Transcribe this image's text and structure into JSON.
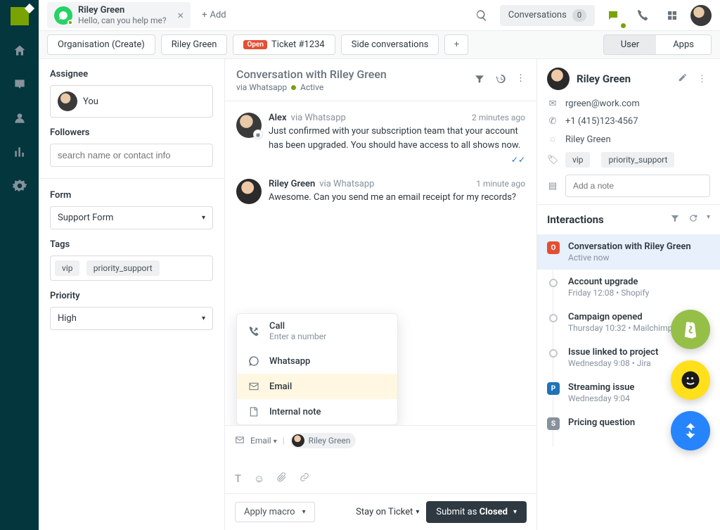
{
  "topbar": {
    "chat_tab": {
      "title": "Riley Green",
      "subtitle": "Hello, can you help me?"
    },
    "add_label": "Add",
    "conversations_label": "Conversations",
    "conversations_count": "0"
  },
  "tabs": {
    "items": [
      "Organisation (Create)",
      "Riley Green"
    ],
    "ticket": {
      "badge": "Open",
      "label": "Ticket #1234"
    },
    "side": "Side conversations",
    "seg_user": "User",
    "seg_apps": "Apps"
  },
  "left": {
    "assignee_label": "Assignee",
    "assignee_value": "You",
    "followers_label": "Followers",
    "followers_placeholder": "search name or contact info",
    "form_label": "Form",
    "form_value": "Support Form",
    "tags_label": "Tags",
    "tags": [
      "vip",
      "priority_support"
    ],
    "priority_label": "Priority",
    "priority_value": "High"
  },
  "conversation": {
    "title": "Conversation with Riley Green",
    "via": "via Whatsapp",
    "status": "Active",
    "messages": [
      {
        "name": "Alex",
        "via": "via Whatsapp",
        "time": "2 minutes ago",
        "text": "Just confirmed with your subscription team that your account has been upgraded. You should have access to all shows now.",
        "checks": true
      },
      {
        "name": "Riley Green",
        "via": "via Whatsapp",
        "time": "1 minute ago",
        "text": "Awesome. Can you send me an email receipt for my records?"
      }
    ],
    "reply_menu": {
      "call": "Call",
      "call_sub": "Enter a number",
      "whatsapp": "Whatsapp",
      "email": "Email",
      "internal": "Internal note"
    },
    "reply_channel": "Email",
    "reply_to": "Riley Green",
    "macro_label": "Apply macro",
    "stay_label": "Stay on Ticket",
    "submit_prefix": "Submit as ",
    "submit_status": "Closed"
  },
  "customer": {
    "name": "Riley Green",
    "email": "rgreen@work.com",
    "phone": "+1 (415)123-4567",
    "whatsapp": "Riley Green",
    "tags": [
      "vip",
      "priority_support"
    ],
    "note_placeholder": "Add a note"
  },
  "interactions": {
    "title": "Interactions",
    "items": [
      {
        "mark": "o",
        "title": "Conversation with Riley Green",
        "sub": "Active now",
        "active": true
      },
      {
        "mark": "circle",
        "title": "Account upgrade",
        "sub": "Friday 12:08 • Shopify"
      },
      {
        "mark": "circle",
        "title": "Campaign opened",
        "sub": "Thursday 10:32 • Mailchimp"
      },
      {
        "mark": "circle",
        "title": "Issue linked to project",
        "sub": "Wednesday 9:08 • Jira"
      },
      {
        "mark": "p",
        "title": "Streaming issue",
        "sub": "Wednesday 9:04"
      },
      {
        "mark": "s",
        "title": "Pricing question",
        "sub": ""
      }
    ]
  }
}
